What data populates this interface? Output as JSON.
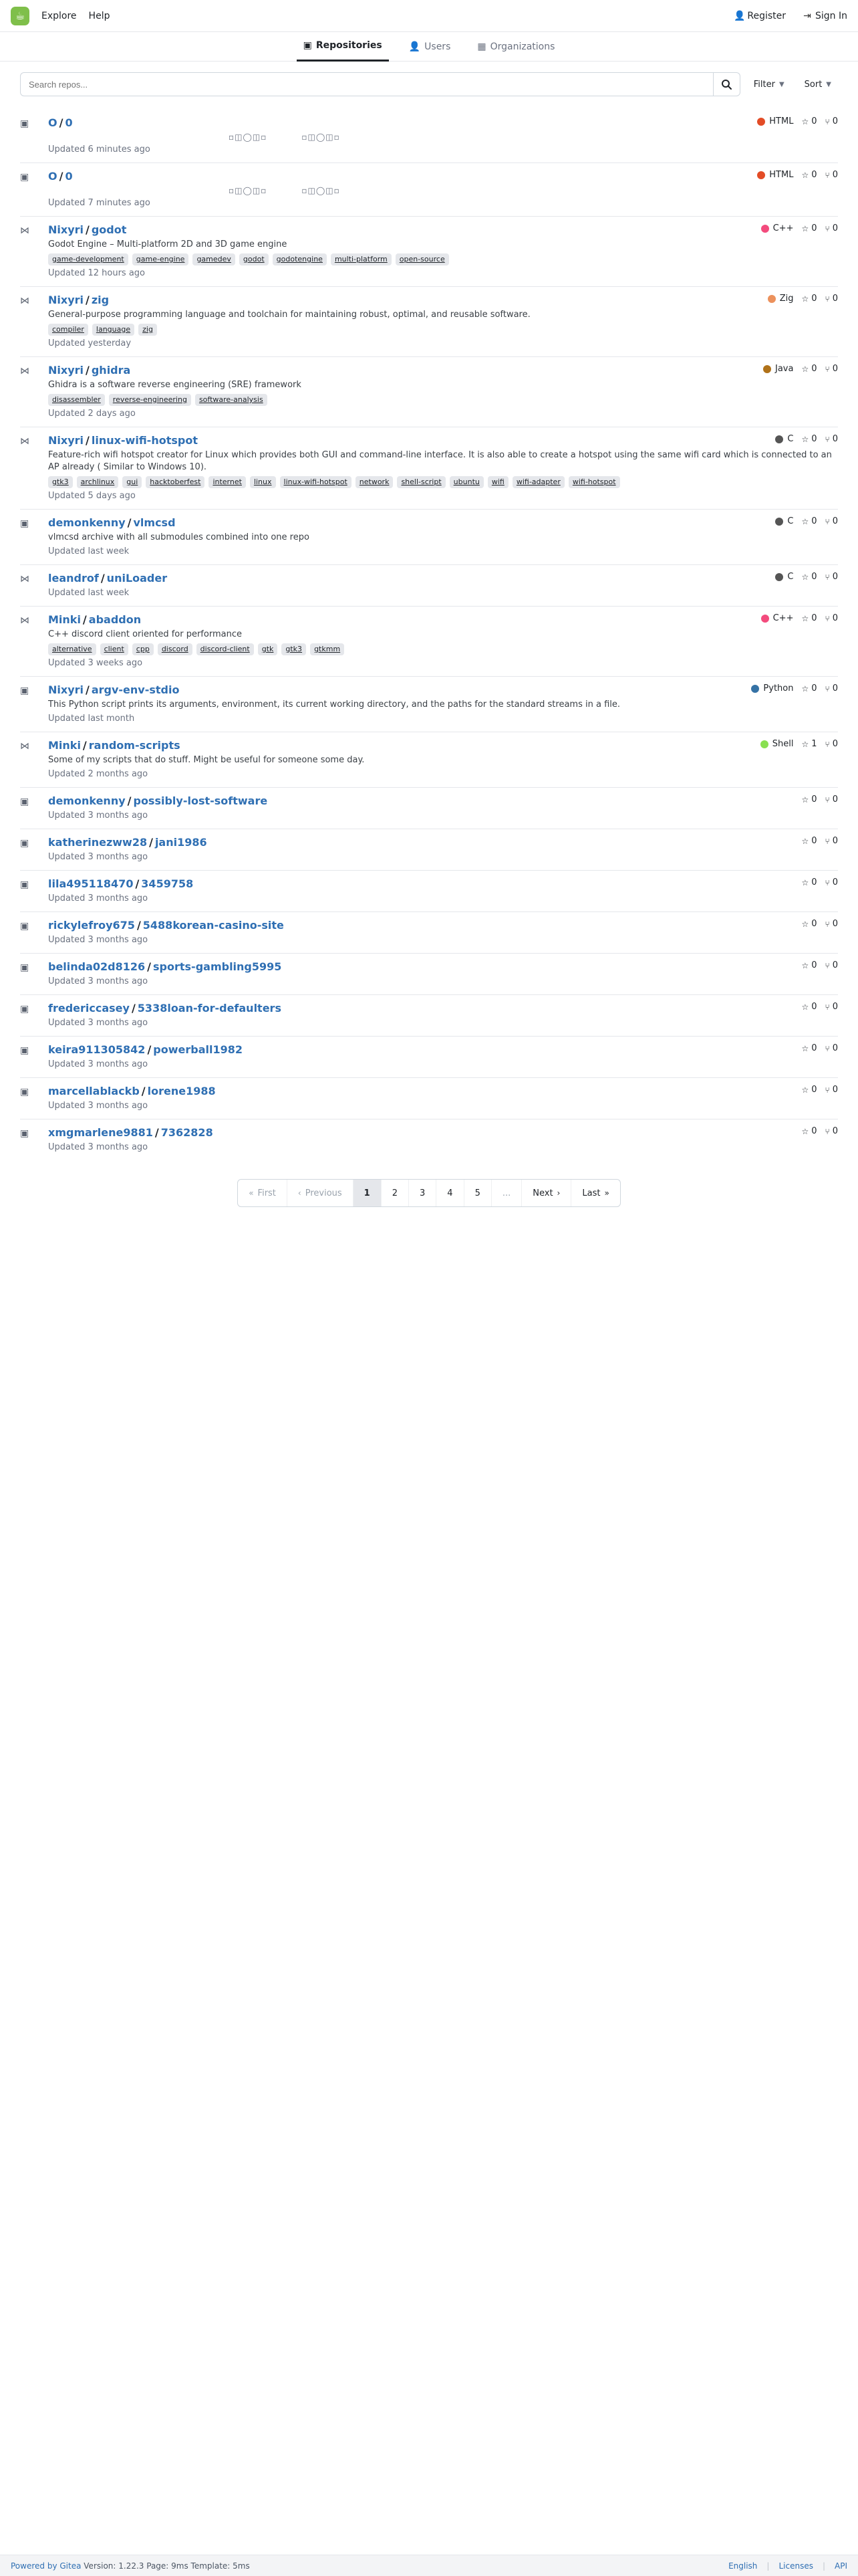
{
  "topbar": {
    "left": [
      {
        "label": "Explore"
      },
      {
        "label": "Help"
      }
    ],
    "right": [
      {
        "label": "Register"
      },
      {
        "label": "Sign In"
      }
    ]
  },
  "tabs": [
    {
      "label": "Repositories"
    },
    {
      "label": "Users"
    },
    {
      "label": "Organizations"
    }
  ],
  "search": {
    "placeholder": "Search repos...",
    "filter_label": "Filter",
    "sort_label": "Sort"
  },
  "repos": [
    {
      "owner": "O",
      "name": "0",
      "lang": "HTML",
      "lang_color": "#e34c26",
      "stars": "0",
      "forks": "0",
      "updated": "Updated 6 minutes ago",
      "glyphs": [
        "▫◫◯◫▫",
        "▫◫◯◫▫"
      ]
    },
    {
      "owner": "O",
      "name": "0",
      "lang": "HTML",
      "lang_color": "#e34c26",
      "stars": "0",
      "forks": "0",
      "updated": "Updated 7 minutes ago",
      "glyphs": [
        "▫◫◯◫▫",
        "▫◫◯◫▫"
      ]
    },
    {
      "owner": "Nixyri",
      "name": "godot",
      "desc": "Godot Engine – Multi-platform 2D and 3D game engine",
      "lang": "C++",
      "lang_color": "#f34b7d",
      "stars": "0",
      "forks": "0",
      "updated": "Updated 12 hours ago",
      "topics": [
        "game-development",
        "game-engine",
        "gamedev",
        "godot",
        "godotengine",
        "multi-platform",
        "open-source"
      ]
    },
    {
      "owner": "Nixyri",
      "name": "zig",
      "desc": "General-purpose programming language and toolchain for maintaining robust, optimal, and reusable software.",
      "lang": "Zig",
      "lang_color": "#ec915c",
      "stars": "0",
      "forks": "0",
      "updated": "Updated yesterday",
      "topics": [
        "compiler",
        "language",
        "zig"
      ]
    },
    {
      "owner": "Nixyri",
      "name": "ghidra",
      "desc": "Ghidra is a software reverse engineering (SRE) framework",
      "lang": "Java",
      "lang_color": "#b07219",
      "stars": "0",
      "forks": "0",
      "updated": "Updated 2 days ago",
      "topics": [
        "disassembler",
        "reverse-engineering",
        "software-analysis"
      ]
    },
    {
      "owner": "Nixyri",
      "name": "linux-wifi-hotspot",
      "desc": "Feature-rich wifi hotspot creator for Linux which provides both GUI and command-line interface. It is also able to create a hotspot using the same wifi card which is connected to an AP already ( Similar to Windows 10).",
      "lang": "C",
      "lang_color": "#555555",
      "stars": "0",
      "forks": "0",
      "updated": "Updated 5 days ago",
      "topics": [
        "gtk3",
        "archlinux",
        "gui",
        "hacktoberfest",
        "internet",
        "linux",
        "linux-wifi-hotspot",
        "network",
        "shell-script",
        "ubuntu",
        "wifi",
        "wifi-adapter",
        "wifi-hotspot"
      ]
    },
    {
      "owner": "demonkenny",
      "name": "vlmcsd",
      "desc": "vlmcsd archive with all submodules combined into one repo",
      "lang": "C",
      "lang_color": "#555555",
      "stars": "0",
      "forks": "0",
      "updated": "Updated last week"
    },
    {
      "owner": "leandrof",
      "name": "uniLoader",
      "lang": "C",
      "lang_color": "#555555",
      "stars": "0",
      "forks": "0",
      "updated": "Updated last week"
    },
    {
      "owner": "Minki",
      "name": "abaddon",
      "desc": "C++ discord client oriented for performance",
      "lang": "C++",
      "lang_color": "#f34b7d",
      "stars": "0",
      "forks": "0",
      "updated": "Updated 3 weeks ago",
      "topics": [
        "alternative",
        "client",
        "cpp",
        "discord",
        "discord-client",
        "gtk",
        "gtk3",
        "gtkmm"
      ]
    },
    {
      "owner": "Nixyri",
      "name": "argv-env-stdio",
      "desc": "This Python script prints its arguments, environment, its current working directory, and the paths for the standard streams in a file.",
      "lang": "Python",
      "lang_color": "#3572A5",
      "stars": "0",
      "forks": "0",
      "updated": "Updated last month"
    },
    {
      "owner": "Minki",
      "name": "random-scripts",
      "desc": "Some of my scripts that do stuff. Might be useful for someone some day.",
      "lang": "Shell",
      "lang_color": "#89e051",
      "stars": "1",
      "forks": "0",
      "updated": "Updated 2 months ago"
    },
    {
      "owner": "demonkenny",
      "name": "possibly-lost-software",
      "stars": "0",
      "forks": "0",
      "updated": "Updated 3 months ago"
    },
    {
      "owner": "katherinezww28",
      "name": "jani1986",
      "stars": "0",
      "forks": "0",
      "updated": "Updated 3 months ago"
    },
    {
      "owner": "lila495118470",
      "name": "3459758",
      "stars": "0",
      "forks": "0",
      "updated": "Updated 3 months ago"
    },
    {
      "owner": "rickylefroy675",
      "name": "5488korean-casino-site",
      "stars": "0",
      "forks": "0",
      "updated": "Updated 3 months ago"
    },
    {
      "owner": "belinda02d8126",
      "name": "sports-gambling5995",
      "stars": "0",
      "forks": "0",
      "updated": "Updated 3 months ago"
    },
    {
      "owner": "fredericcasey",
      "name": "5338loan-for-defaulters",
      "stars": "0",
      "forks": "0",
      "updated": "Updated 3 months ago"
    },
    {
      "owner": "keira911305842",
      "name": "powerball1982",
      "stars": "0",
      "forks": "0",
      "updated": "Updated 3 months ago"
    },
    {
      "owner": "marcellablackb",
      "name": "lorene1988",
      "stars": "0",
      "forks": "0",
      "updated": "Updated 3 months ago"
    },
    {
      "owner": "xmgmarlene9881",
      "name": "7362828",
      "stars": "0",
      "forks": "0",
      "updated": "Updated 3 months ago"
    }
  ],
  "pagination": {
    "first": "First",
    "previous": "Previous",
    "pages": [
      "1",
      "2",
      "3",
      "4",
      "5",
      "..."
    ],
    "current": "1",
    "next": "Next",
    "last": "Last"
  },
  "footer": {
    "left_prefix": "Powered by Gitea",
    "left_rest": "Version: 1.22.3 Page: 9ms Template: 5ms",
    "right": [
      "English",
      "Licenses",
      "API"
    ]
  },
  "colors": {
    "link": "#2f6fb3",
    "active_tab_underline": "#1f2328"
  },
  "icons": {
    "logo": "gitea-logo-icon",
    "register": "user-plus-icon",
    "signin": "sign-in-icon",
    "tab_repos": "repo-icon",
    "tab_users": "user-icon",
    "tab_orgs": "org-icon",
    "search": "search-icon",
    "star": "star-icon",
    "fork": "fork-icon",
    "repo": "repo-icon",
    "mirror": "mirror-icon"
  }
}
